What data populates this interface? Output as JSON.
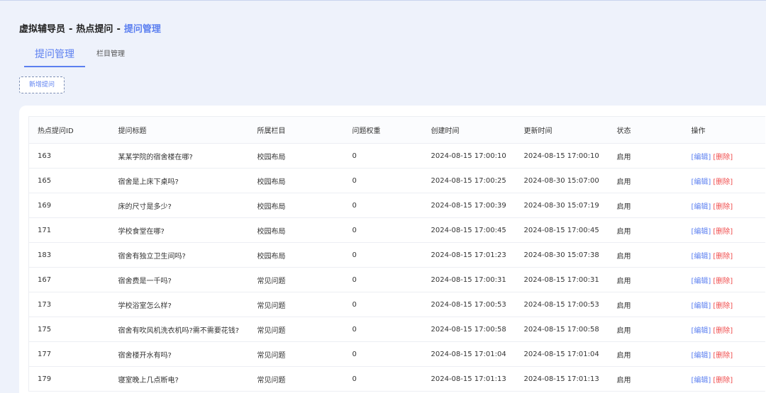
{
  "breadcrumb": {
    "level1": "虚拟辅导员",
    "level2": "热点提问",
    "current": "提问管理",
    "separator": "-"
  },
  "tabs": [
    {
      "label": "提问管理",
      "active": true
    },
    {
      "label": "栏目管理",
      "active": false
    }
  ],
  "toolbar": {
    "add_label": "新增提问"
  },
  "table": {
    "headers": [
      "热点提问ID",
      "提问标题",
      "所属栏目",
      "问题权重",
      "创建时间",
      "更新时间",
      "状态",
      "操作"
    ],
    "edit_label": "[编辑]",
    "delete_label": "[删除]",
    "rows": [
      {
        "id": "163",
        "title": "某某学院的宿舍楼在哪?",
        "category": "校园布局",
        "weight": "0",
        "created": "2024-08-15 17:00:10",
        "updated": "2024-08-15 17:00:10",
        "status": "启用"
      },
      {
        "id": "165",
        "title": "宿舍是上床下桌吗?",
        "category": "校园布局",
        "weight": "0",
        "created": "2024-08-15 17:00:25",
        "updated": "2024-08-30 15:07:00",
        "status": "启用"
      },
      {
        "id": "169",
        "title": "床的尺寸是多少?",
        "category": "校园布局",
        "weight": "0",
        "created": "2024-08-15 17:00:39",
        "updated": "2024-08-30 15:07:19",
        "status": "启用"
      },
      {
        "id": "171",
        "title": "学校食堂在哪?",
        "category": "校园布局",
        "weight": "0",
        "created": "2024-08-15 17:00:45",
        "updated": "2024-08-15 17:00:45",
        "status": "启用"
      },
      {
        "id": "183",
        "title": "宿舍有独立卫生间吗?",
        "category": "校园布局",
        "weight": "0",
        "created": "2024-08-15 17:01:23",
        "updated": "2024-08-30 15:07:38",
        "status": "启用"
      },
      {
        "id": "167",
        "title": "宿舍费是一千吗?",
        "category": "常见问题",
        "weight": "0",
        "created": "2024-08-15 17:00:31",
        "updated": "2024-08-15 17:00:31",
        "status": "启用"
      },
      {
        "id": "173",
        "title": "学校浴室怎么样?",
        "category": "常见问题",
        "weight": "0",
        "created": "2024-08-15 17:00:53",
        "updated": "2024-08-15 17:00:53",
        "status": "启用"
      },
      {
        "id": "175",
        "title": "宿舍有吹风机洗衣机吗?需不需要花钱?",
        "category": "常见问题",
        "weight": "0",
        "created": "2024-08-15 17:00:58",
        "updated": "2024-08-15 17:00:58",
        "status": "启用"
      },
      {
        "id": "177",
        "title": "宿舍楼开水有吗?",
        "category": "常见问题",
        "weight": "0",
        "created": "2024-08-15 17:01:04",
        "updated": "2024-08-15 17:01:04",
        "status": "启用"
      },
      {
        "id": "179",
        "title": "寝室晚上几点断电?",
        "category": "常见问题",
        "weight": "0",
        "created": "2024-08-15 17:01:13",
        "updated": "2024-08-15 17:01:13",
        "status": "启用"
      }
    ]
  },
  "colors": {
    "accent": "#5b7ff0",
    "enabled": "#22a035",
    "danger": "#f04c4c",
    "background": "#eef2fb"
  }
}
